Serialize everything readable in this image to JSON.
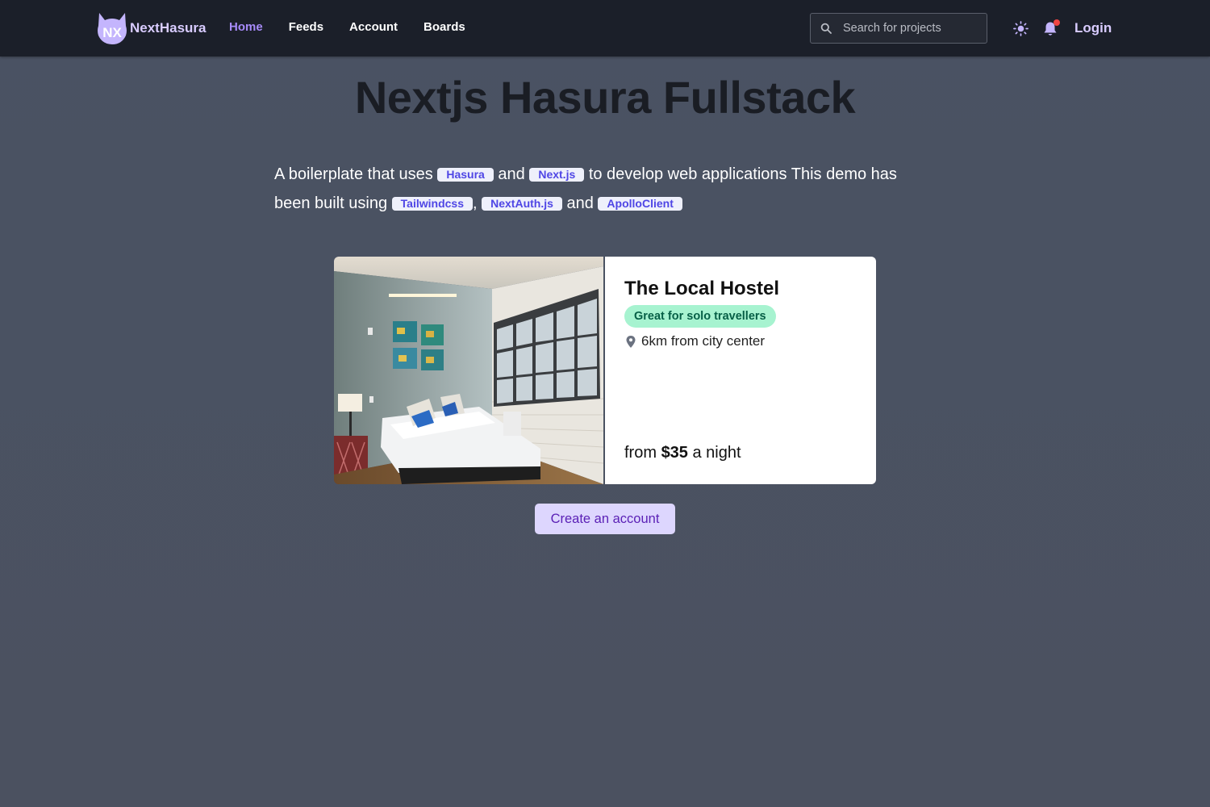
{
  "colors": {
    "navbar_bg": "#1b1f29",
    "page_bg": "#4a5263",
    "accent": "#a78bfa",
    "pill_bg": "#eef0fb",
    "pill_text": "#4f46e5",
    "badge_bg": "#a7f3d0",
    "badge_text": "#065f46",
    "cta_bg": "#ddd6fe",
    "cta_text": "#5b21b6",
    "notification_dot": "#ef4444"
  },
  "navbar": {
    "logo_icon": "nexthasura-logo",
    "brand": "NextHasura",
    "links": [
      {
        "label": "Home",
        "active": true
      },
      {
        "label": "Feeds",
        "active": false
      },
      {
        "label": "Account",
        "active": false
      },
      {
        "label": "Boards",
        "active": false
      }
    ],
    "search": {
      "placeholder": "Search for projects",
      "value": "",
      "icon": "search-icon"
    },
    "theme_toggle_icon": "sun-icon",
    "notifications_icon": "bell-icon",
    "login": "Login"
  },
  "hero": {
    "title": "Nextjs Hasura Fullstack",
    "intro": {
      "t1": "A boilerplate that uses",
      "pill1": "Hasura",
      "t2": "and",
      "pill2": "Next.js",
      "t3": "to develop web applications This demo has been built using",
      "pill3": "Tailwindcss",
      "t4": ",",
      "pill4": "NextAuth.js",
      "t5": "and",
      "pill5": "ApolloClient"
    }
  },
  "card": {
    "image_alt": "hostel-bedroom-photo",
    "title": "The Local Hostel",
    "badge": "Great for solo travellers",
    "location_icon": "map-pin-icon",
    "location": "6km from city center",
    "price_prefix": "from",
    "price_value": "$35",
    "price_suffix": "a night"
  },
  "cta": {
    "label": "Create an account"
  }
}
